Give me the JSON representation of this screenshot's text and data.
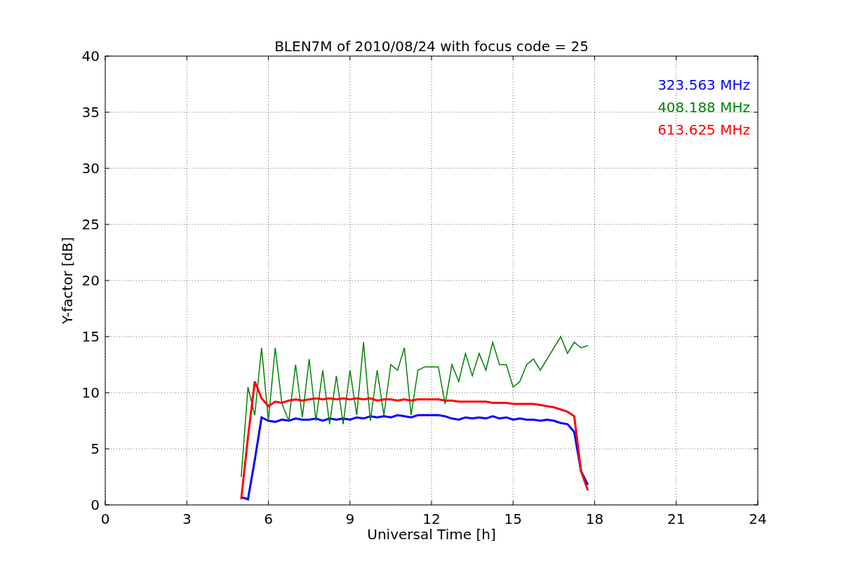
{
  "chart_data": {
    "type": "line",
    "grid": true,
    "title": "BLEN7M of 2010/08/24 with focus code = 25",
    "xlabel": "Universal Time [h]",
    "ylabel": "Y-factor [dB]",
    "xlim": [
      0,
      24
    ],
    "ylim": [
      0,
      40
    ],
    "xticks": [
      0,
      3,
      6,
      9,
      12,
      15,
      18,
      21,
      24
    ],
    "yticks": [
      0,
      5,
      10,
      15,
      20,
      25,
      30,
      35,
      40
    ],
    "x": [
      5,
      5.25,
      5.5,
      5.75,
      6,
      6.25,
      6.5,
      6.75,
      7,
      7.25,
      7.5,
      7.75,
      8,
      8.25,
      8.5,
      8.75,
      9,
      9.25,
      9.5,
      9.75,
      10,
      10.25,
      10.5,
      10.75,
      11,
      11.25,
      11.5,
      11.75,
      12,
      12.25,
      12.5,
      12.75,
      13,
      13.25,
      13.5,
      13.75,
      14,
      14.25,
      14.5,
      14.75,
      15,
      15.25,
      15.5,
      15.75,
      16,
      16.25,
      16.5,
      16.75,
      17,
      17.25,
      17.5,
      17.75
    ],
    "series": [
      {
        "name": "323.563 MHz",
        "color": "#0000ff",
        "values": [
          0.7,
          0.5,
          4,
          7.8,
          7.5,
          7.4,
          7.6,
          7.5,
          7.7,
          7.6,
          7.6,
          7.7,
          7.5,
          7.7,
          7.6,
          7.7,
          7.6,
          7.8,
          7.7,
          7.9,
          7.8,
          7.9,
          7.8,
          8.0,
          7.9,
          7.8,
          8.0,
          8.0,
          8.0,
          8.0,
          7.9,
          7.7,
          7.6,
          7.8,
          7.7,
          7.8,
          7.7,
          7.9,
          7.7,
          7.8,
          7.6,
          7.7,
          7.6,
          7.6,
          7.5,
          7.6,
          7.5,
          7.3,
          7.2,
          6.5,
          3,
          1.8
        ]
      },
      {
        "name": "408.188 MHz",
        "color": "#008000",
        "values": [
          2.5,
          10.5,
          8,
          14,
          7.5,
          14,
          9,
          7.5,
          12.5,
          7.8,
          13,
          7.5,
          12,
          7.2,
          11.5,
          7.2,
          12,
          8,
          14.5,
          7.5,
          12,
          8,
          12.5,
          12,
          14,
          8,
          12,
          12.3,
          12.3,
          12.3,
          9,
          12.5,
          11,
          13.5,
          11.5,
          13.5,
          12,
          14.5,
          12.5,
          12.5,
          10.5,
          11,
          12.5,
          13,
          12,
          13,
          14,
          15,
          13.5,
          14.5,
          14,
          14.2
        ]
      },
      {
        "name": "613.625 MHz",
        "color": "#ff0000",
        "values": [
          0.5,
          6,
          11,
          9.5,
          8.8,
          9.2,
          9.1,
          9.3,
          9.4,
          9.3,
          9.4,
          9.5,
          9.4,
          9.5,
          9.4,
          9.5,
          9.4,
          9.5,
          9.4,
          9.5,
          9.3,
          9.4,
          9.4,
          9.3,
          9.4,
          9.3,
          9.4,
          9.4,
          9.4,
          9.4,
          9.3,
          9.3,
          9.2,
          9.2,
          9.2,
          9.2,
          9.2,
          9.1,
          9.1,
          9.1,
          9.0,
          9.0,
          9.0,
          9.0,
          8.9,
          8.8,
          8.7,
          8.5,
          8.3,
          7.9,
          3,
          1.3
        ]
      }
    ]
  }
}
